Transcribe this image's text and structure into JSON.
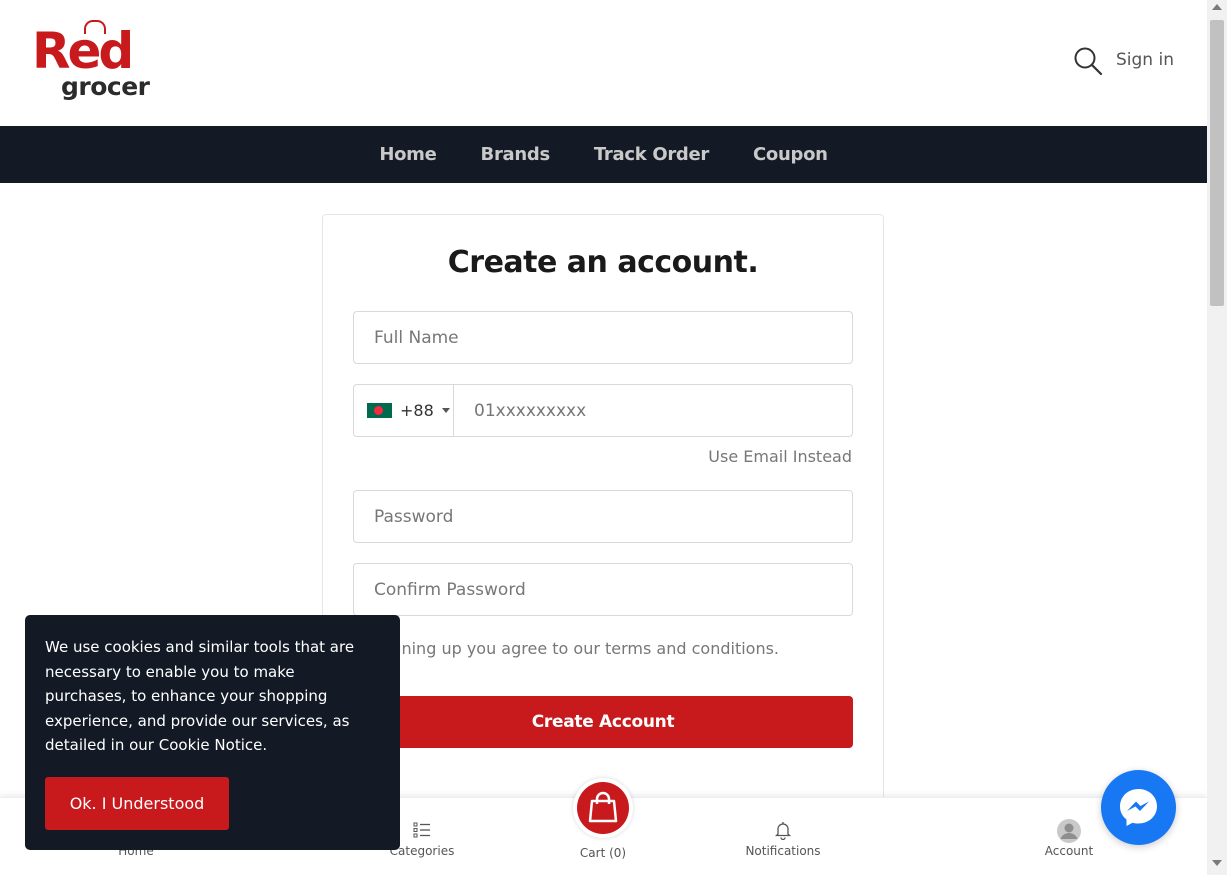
{
  "brand": {
    "logo_top": "Red",
    "logo_bottom": "grocer",
    "accent_color": "#c8191d",
    "nav_bg": "#131a25"
  },
  "header": {
    "signin_label": "Sign in",
    "search_icon": "search-icon"
  },
  "nav": {
    "items": [
      "Home",
      "Brands",
      "Track Order",
      "Coupon"
    ]
  },
  "form": {
    "title": "Create an account.",
    "full_name_placeholder": "Full Name",
    "country_code": "+88",
    "country_flag": "bangladesh-flag-icon",
    "phone_placeholder": "01xxxxxxxxx",
    "use_email_label": "Use Email Instead",
    "password_placeholder": "Password",
    "confirm_password_placeholder": "Confirm Password",
    "terms_text": "By signing up you agree to our terms and conditions.",
    "submit_label": "Create Account"
  },
  "bottom_nav": {
    "home": "Home",
    "categories": "Categories",
    "cart": "Cart (0)",
    "notifications": "Notifications",
    "account": "Account"
  },
  "cookie": {
    "message": "We use cookies and similar tools that are necessary to enable you to make purchases, to enhance your shopping experience, and provide our services, as detailed in our Cookie Notice.",
    "button_label": "Ok. I Understood"
  }
}
